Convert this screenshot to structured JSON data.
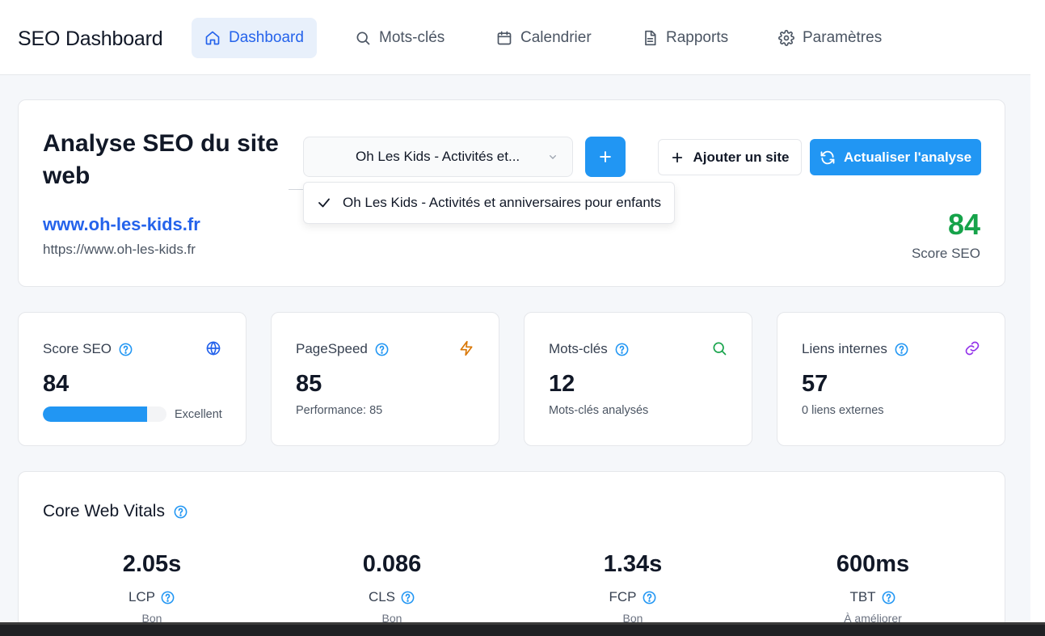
{
  "nav": {
    "brand": "SEO Dashboard",
    "items": [
      {
        "label": "Dashboard",
        "icon": "home-icon",
        "active": true
      },
      {
        "label": "Mots-clés",
        "icon": "search-icon",
        "active": false
      },
      {
        "label": "Calendrier",
        "icon": "calendar-icon",
        "active": false
      },
      {
        "label": "Rapports",
        "icon": "document-icon",
        "active": false
      },
      {
        "label": "Paramètres",
        "icon": "gear-icon",
        "active": false
      }
    ]
  },
  "header": {
    "title": "Analyse SEO du site web",
    "domain": "www.oh-les-kids.fr",
    "url": "https://www.oh-les-kids.fr",
    "site_select_value": "Oh Les Kids - Activités et...",
    "dropdown_option": "Oh Les Kids - Activités et anniversaires pour enfants",
    "add_site_label": "Ajouter un site",
    "refresh_label": "Actualiser l'analyse",
    "score_value": "84",
    "score_label": "Score SEO"
  },
  "stats": {
    "seo": {
      "label": "Score SEO",
      "value": "84",
      "progress": 0.84,
      "progress_label": "Excellent",
      "icon": "globe-icon"
    },
    "pagespeed": {
      "label": "PageSpeed",
      "value": "85",
      "sub": "Performance: 85",
      "icon": "lightning-icon"
    },
    "keywords": {
      "label": "Mots-clés",
      "value": "12",
      "sub": "Mots-clés analysés",
      "icon": "search-icon"
    },
    "links": {
      "label": "Liens internes",
      "value": "57",
      "sub": "0 liens externes",
      "icon": "link-icon"
    }
  },
  "vitals": {
    "title": "Core Web Vitals",
    "items": [
      {
        "value": "2.05s",
        "name": "LCP",
        "status": "Bon"
      },
      {
        "value": "0.086",
        "name": "CLS",
        "status": "Bon"
      },
      {
        "value": "1.34s",
        "name": "FCP",
        "status": "Bon"
      },
      {
        "value": "600ms",
        "name": "TBT",
        "status": "À améliorer"
      }
    ]
  },
  "colors": {
    "accent": "#2196f3",
    "link": "#2563eb",
    "score_good": "#16a34a",
    "pagespeed_icon": "#d97706",
    "keywords_icon": "#16a34a",
    "links_icon": "#9333ea"
  }
}
